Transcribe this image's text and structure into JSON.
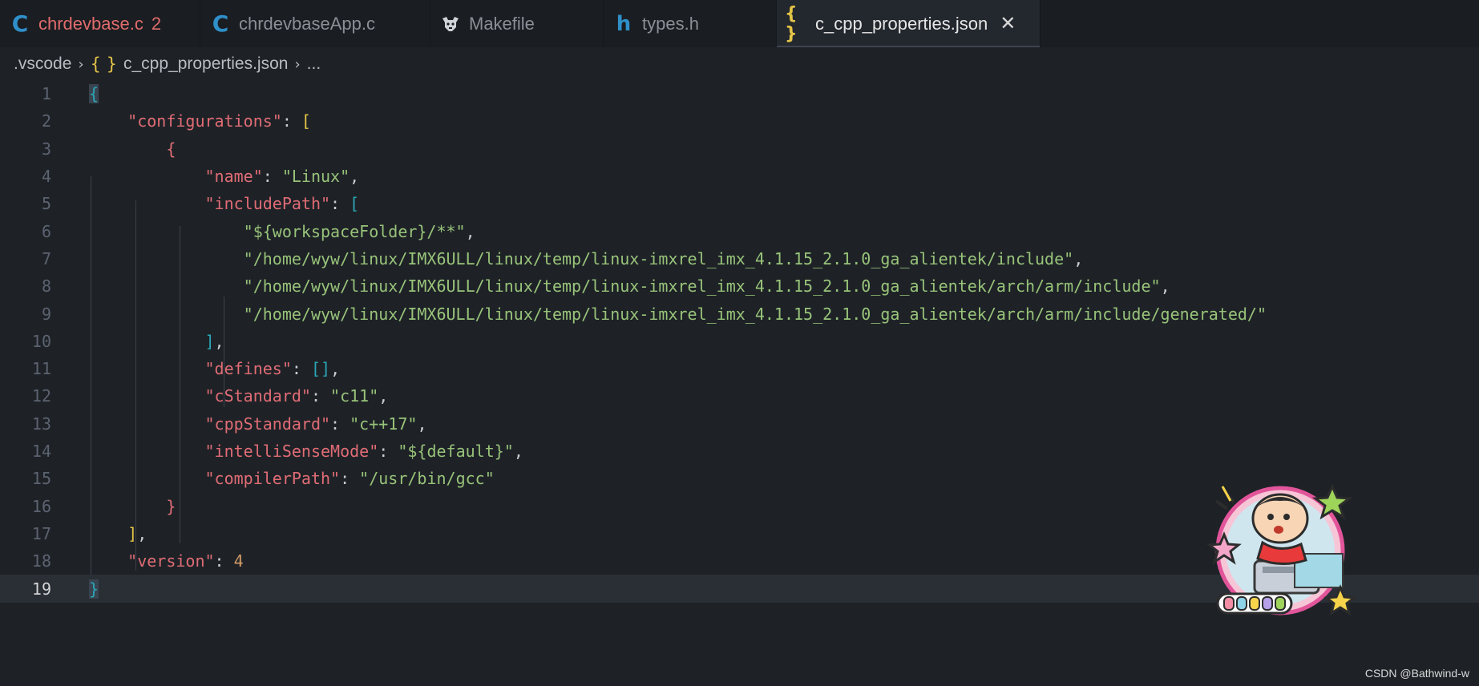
{
  "tabs": [
    {
      "icon": "c-file-icon",
      "glyph": "C",
      "label": "chrdevbase.c",
      "badge": "2",
      "error": true
    },
    {
      "icon": "c-file-icon",
      "glyph": "C",
      "label": "chrdevbaseApp.c"
    },
    {
      "icon": "makefile-icon",
      "glyph": "🐃",
      "label": "Makefile"
    },
    {
      "icon": "h-file-icon",
      "glyph": "h",
      "label": "types.h"
    },
    {
      "icon": "json-file-icon",
      "glyph": "{ }",
      "label": "c_cpp_properties.json",
      "active": true,
      "close": "✕"
    }
  ],
  "breadcrumb": {
    "folder": ".vscode",
    "file_icon": "{ }",
    "file": "c_cpp_properties.json",
    "more": "..."
  },
  "line_numbers": [
    "1",
    "2",
    "3",
    "4",
    "5",
    "6",
    "7",
    "8",
    "9",
    "10",
    "11",
    "12",
    "13",
    "14",
    "15",
    "16",
    "17",
    "18",
    "19"
  ],
  "code": {
    "configurations_key": "\"configurations\"",
    "name_key": "\"name\"",
    "name_val": "\"Linux\"",
    "include_key": "\"includePath\"",
    "inc1": "\"${workspaceFolder}/**\"",
    "inc2": "\"/home/wyw/linux/IMX6ULL/linux/temp/linux-imxrel_imx_4.1.15_2.1.0_ga_alientek/include\"",
    "inc3": "\"/home/wyw/linux/IMX6ULL/linux/temp/linux-imxrel_imx_4.1.15_2.1.0_ga_alientek/arch/arm/include\"",
    "inc4": "\"/home/wyw/linux/IMX6ULL/linux/temp/linux-imxrel_imx_4.1.15_2.1.0_ga_alientek/arch/arm/include/generated/\"",
    "defines_key": "\"defines\"",
    "cstd_key": "\"cStandard\"",
    "cstd_val": "\"c11\"",
    "cppstd_key": "\"cppStandard\"",
    "cppstd_val": "\"c++17\"",
    "intelli_key": "\"intelliSenseMode\"",
    "intelli_val": "\"${default}\"",
    "compiler_key": "\"compilerPath\"",
    "compiler_val": "\"/usr/bin/gcc\"",
    "version_key": "\"version\"",
    "version_val": "4"
  },
  "watermark": "CSDN @Bathwind-w"
}
